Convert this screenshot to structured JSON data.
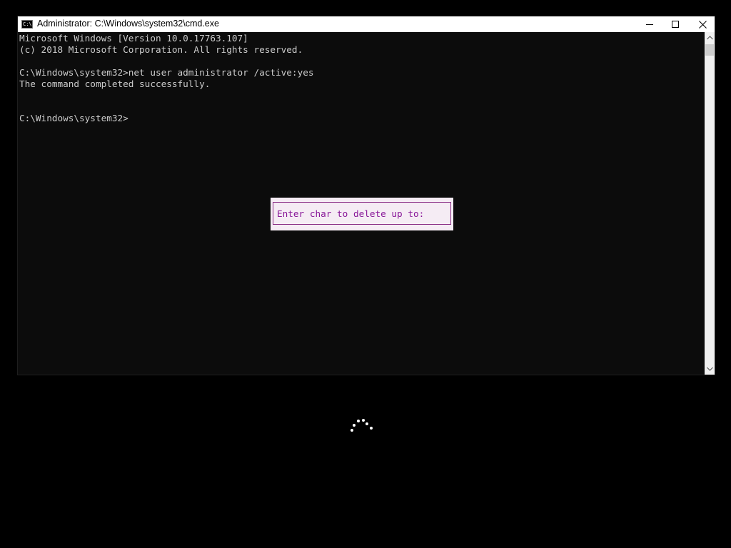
{
  "window": {
    "title": "Administrator: C:\\Windows\\system32\\cmd.exe",
    "icon_label": "C:\\",
    "icons": {
      "app": "cmd-icon",
      "minimize": "minimize-icon",
      "maximize": "maximize-icon",
      "close": "close-icon"
    }
  },
  "console": {
    "lines": [
      "Microsoft Windows [Version 10.0.17763.107]",
      "(c) 2018 Microsoft Corporation. All rights reserved.",
      "C:\\Windows\\system32>net user administrator /active:yes",
      "The command completed successfully.",
      "C:\\Windows\\system32>"
    ],
    "text_color": "#cccccc",
    "background": "#0c0c0c"
  },
  "popup": {
    "prompt": "Enter char to delete up to:",
    "text_color": "#881798",
    "background": "#f5ecf4"
  },
  "scrollbar": {
    "icons": [
      "chevron-up-icon",
      "chevron-down-icon"
    ]
  },
  "desktop": {
    "background": "#000000",
    "spinner": "loading-spinner-icon"
  }
}
